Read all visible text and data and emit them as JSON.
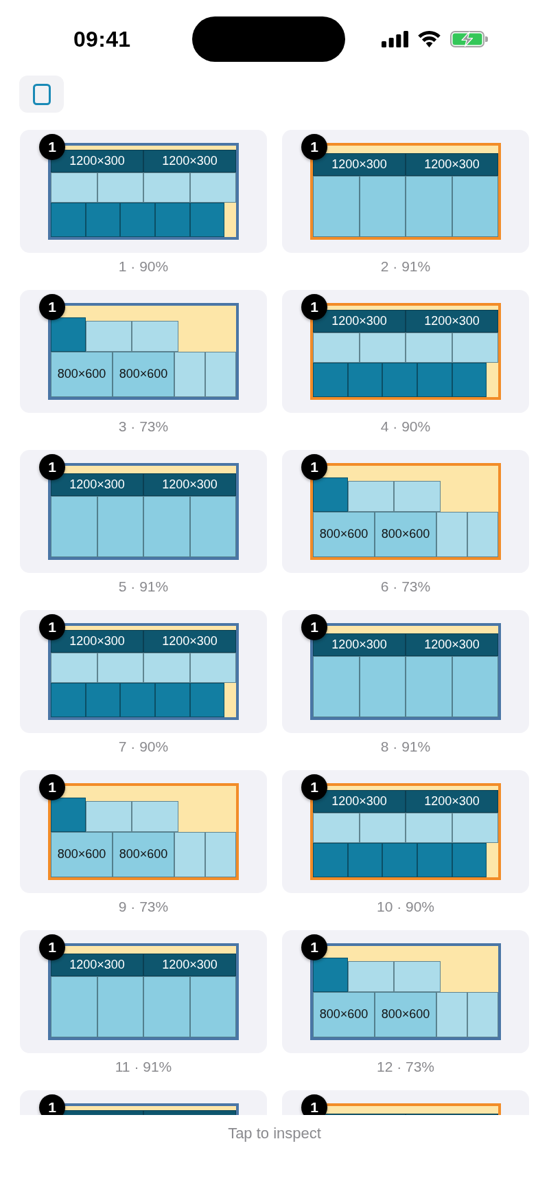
{
  "status_bar": {
    "time": "09:41"
  },
  "cards": [
    {
      "badge": "1",
      "color": "#4a76a6",
      "preview": {
        "kind": "three-row",
        "rows": [
          {
            "tiles": [
              {
                "kind": "banner",
                "label": "1200×300"
              },
              {
                "kind": "banner",
                "label": "1200×300"
              }
            ]
          },
          {
            "tiles": [
              {
                "kind": "light"
              },
              {
                "kind": "light"
              },
              {
                "kind": "light"
              },
              {
                "kind": "light"
              }
            ]
          },
          {
            "tiles": [
              {
                "kind": "teal"
              },
              {
                "kind": "teal"
              },
              {
                "kind": "teal"
              },
              {
                "kind": "teal"
              },
              {
                "kind": "teal"
              }
            ]
          }
        ]
      },
      "caption": "1 · 90%"
    },
    {
      "badge": "1",
      "color": "#f28c28",
      "preview": {
        "kind": "two-row",
        "rows": [
          {
            "tiles": [
              {
                "kind": "banner",
                "label": "1200×300"
              },
              {
                "kind": "banner",
                "label": "1200×300"
              }
            ]
          },
          {
            "tiles": [
              {
                "kind": "medium"
              },
              {
                "kind": "medium"
              },
              {
                "kind": "medium"
              },
              {
                "kind": "medium"
              }
            ]
          }
        ]
      },
      "caption": "2 · 91%"
    },
    {
      "badge": "1",
      "color": "#4a76a6",
      "preview": {
        "kind": "stepped",
        "rows": [
          {
            "tiles": [
              {
                "kind": "teal"
              },
              {
                "kind": "light"
              },
              {
                "kind": "light"
              }
            ]
          },
          {
            "tiles": [
              {
                "kind": "medium-wide",
                "label": "800×600"
              },
              {
                "kind": "medium-wide",
                "label": "800×600"
              },
              {
                "kind": "light-tall"
              },
              {
                "kind": "light-tall"
              }
            ]
          }
        ]
      },
      "caption": "3 · 73%"
    },
    {
      "badge": "1",
      "color": "#f28c28",
      "preview": {
        "kind": "three-row",
        "rows": [
          {
            "tiles": [
              {
                "kind": "banner",
                "label": "1200×300"
              },
              {
                "kind": "banner",
                "label": "1200×300"
              }
            ]
          },
          {
            "tiles": [
              {
                "kind": "light"
              },
              {
                "kind": "light"
              },
              {
                "kind": "light"
              },
              {
                "kind": "light"
              }
            ]
          },
          {
            "tiles": [
              {
                "kind": "teal"
              },
              {
                "kind": "teal"
              },
              {
                "kind": "teal"
              },
              {
                "kind": "teal"
              },
              {
                "kind": "teal"
              }
            ]
          }
        ]
      },
      "caption": "4 · 90%"
    },
    {
      "badge": "1",
      "color": "#4a76a6",
      "preview": {
        "kind": "two-row",
        "rows": [
          {
            "tiles": [
              {
                "kind": "banner",
                "label": "1200×300"
              },
              {
                "kind": "banner",
                "label": "1200×300"
              }
            ]
          },
          {
            "tiles": [
              {
                "kind": "medium"
              },
              {
                "kind": "medium"
              },
              {
                "kind": "medium"
              },
              {
                "kind": "medium"
              }
            ]
          }
        ]
      },
      "caption": "5 · 91%"
    },
    {
      "badge": "1",
      "color": "#f28c28",
      "preview": {
        "kind": "stepped",
        "rows": [
          {
            "tiles": [
              {
                "kind": "teal"
              },
              {
                "kind": "light"
              },
              {
                "kind": "light"
              }
            ]
          },
          {
            "tiles": [
              {
                "kind": "medium-wide",
                "label": "800×600"
              },
              {
                "kind": "medium-wide",
                "label": "800×600"
              },
              {
                "kind": "light-tall"
              },
              {
                "kind": "light-tall"
              }
            ]
          }
        ]
      },
      "caption": "6 · 73%"
    },
    {
      "badge": "1",
      "color": "#4a76a6",
      "preview": {
        "kind": "three-row",
        "rows": [
          {
            "tiles": [
              {
                "kind": "banner",
                "label": "1200×300"
              },
              {
                "kind": "banner",
                "label": "1200×300"
              }
            ]
          },
          {
            "tiles": [
              {
                "kind": "light"
              },
              {
                "kind": "light"
              },
              {
                "kind": "light"
              },
              {
                "kind": "light"
              }
            ]
          },
          {
            "tiles": [
              {
                "kind": "teal"
              },
              {
                "kind": "teal"
              },
              {
                "kind": "teal"
              },
              {
                "kind": "teal"
              },
              {
                "kind": "teal"
              }
            ]
          }
        ]
      },
      "caption": "7 · 90%"
    },
    {
      "badge": "1",
      "color": "#4a76a6",
      "preview": {
        "kind": "two-row",
        "rows": [
          {
            "tiles": [
              {
                "kind": "banner",
                "label": "1200×300"
              },
              {
                "kind": "banner",
                "label": "1200×300"
              }
            ]
          },
          {
            "tiles": [
              {
                "kind": "medium"
              },
              {
                "kind": "medium"
              },
              {
                "kind": "medium"
              },
              {
                "kind": "medium"
              }
            ]
          }
        ]
      },
      "caption": "8 · 91%"
    },
    {
      "badge": "1",
      "color": "#f28c28",
      "preview": {
        "kind": "stepped",
        "rows": [
          {
            "tiles": [
              {
                "kind": "teal"
              },
              {
                "kind": "light"
              },
              {
                "kind": "light"
              }
            ]
          },
          {
            "tiles": [
              {
                "kind": "medium-wide",
                "label": "800×600"
              },
              {
                "kind": "medium-wide",
                "label": "800×600"
              },
              {
                "kind": "light-tall"
              },
              {
                "kind": "light-tall"
              }
            ]
          }
        ]
      },
      "caption": "9 · 73%"
    },
    {
      "badge": "1",
      "color": "#f28c28",
      "preview": {
        "kind": "three-row",
        "rows": [
          {
            "tiles": [
              {
                "kind": "banner",
                "label": "1200×300"
              },
              {
                "kind": "banner",
                "label": "1200×300"
              }
            ]
          },
          {
            "tiles": [
              {
                "kind": "light"
              },
              {
                "kind": "light"
              },
              {
                "kind": "light"
              },
              {
                "kind": "light"
              }
            ]
          },
          {
            "tiles": [
              {
                "kind": "teal"
              },
              {
                "kind": "teal"
              },
              {
                "kind": "teal"
              },
              {
                "kind": "teal"
              },
              {
                "kind": "teal"
              }
            ]
          }
        ]
      },
      "caption": "10 · 90%"
    },
    {
      "badge": "1",
      "color": "#4a76a6",
      "preview": {
        "kind": "two-row",
        "rows": [
          {
            "tiles": [
              {
                "kind": "banner",
                "label": "1200×300"
              },
              {
                "kind": "banner",
                "label": "1200×300"
              }
            ]
          },
          {
            "tiles": [
              {
                "kind": "medium"
              },
              {
                "kind": "medium"
              },
              {
                "kind": "medium"
              },
              {
                "kind": "medium"
              }
            ]
          }
        ]
      },
      "caption": "11 · 91%"
    },
    {
      "badge": "1",
      "color": "#4a76a6",
      "preview": {
        "kind": "stepped",
        "rows": [
          {
            "tiles": [
              {
                "kind": "teal"
              },
              {
                "kind": "light"
              },
              {
                "kind": "light"
              }
            ]
          },
          {
            "tiles": [
              {
                "kind": "medium-wide",
                "label": "800×600"
              },
              {
                "kind": "medium-wide",
                "label": "800×600"
              },
              {
                "kind": "light-tall"
              },
              {
                "kind": "light-tall"
              }
            ]
          }
        ]
      },
      "caption": "12 · 73%"
    },
    {
      "badge": "1",
      "color": "#4a76a6",
      "preview": {
        "kind": "three-row",
        "rows": [
          {
            "tiles": [
              {
                "kind": "banner"
              },
              {
                "kind": "banner"
              }
            ]
          }
        ]
      }
    },
    {
      "badge": "1",
      "color": "#f28c28",
      "preview": {
        "kind": "two-row",
        "rows": [
          {
            "tiles": [
              {
                "kind": "banner"
              },
              {
                "kind": "banner"
              }
            ]
          }
        ]
      }
    }
  ],
  "footer": {
    "hint": "Tap to inspect"
  }
}
